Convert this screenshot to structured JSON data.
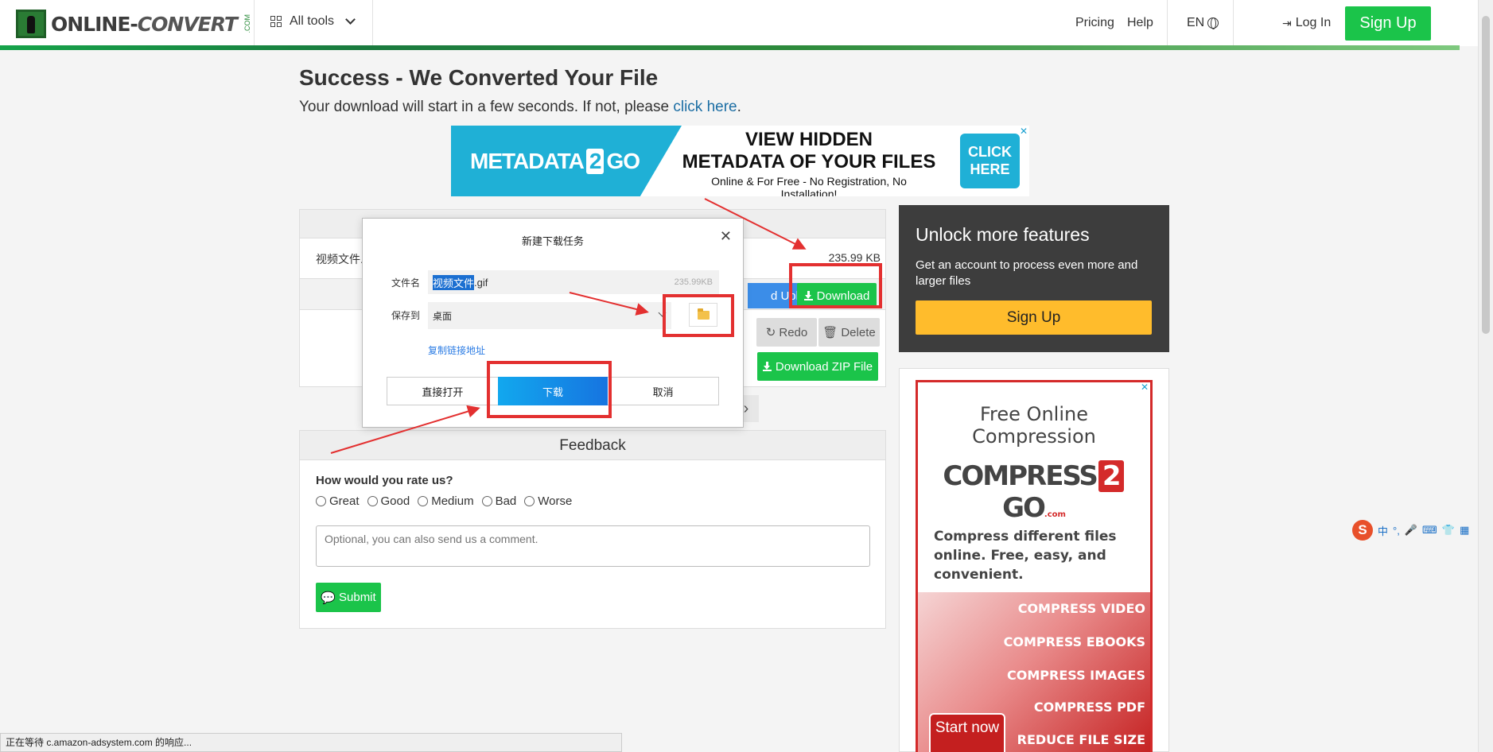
{
  "header": {
    "logo_main": "ONLINE-",
    "logo_conv": "CONVERT",
    "logo_com": ".COM",
    "all_tools": "All tools",
    "pricing": "Pricing",
    "help": "Help",
    "lang": "EN",
    "login": "Log In",
    "signup": "Sign Up"
  },
  "main": {
    "title": "Success - We Converted Your File",
    "subtitle_prefix": "Your download will start in a few seconds. If not, please ",
    "subtitle_link": "click here",
    "subtitle_suffix": "."
  },
  "banner_ad": {
    "brand_a": "METADATA",
    "brand_two": "2",
    "brand_b": "GO",
    "headline_1": "VIEW HIDDEN",
    "headline_2": "METADATA OF YOUR FILES",
    "tagline": "Online & For Free - No Registration, No Installation!",
    "cta": "CLICK HERE",
    "close": "✕"
  },
  "conversion": {
    "filename_partial": "视频文件.",
    "file_size": "235.99 KB",
    "upload_label": "d Upload",
    "download_label": "Download",
    "redo_label": "Redo",
    "delete_label": "Delete",
    "zip_label": "Download ZIP File"
  },
  "feedback": {
    "heading": "Feedback",
    "question": "How would you rate us?",
    "options": [
      "Great",
      "Good",
      "Medium",
      "Bad",
      "Worse"
    ],
    "comment_placeholder": "Optional, you can also send us a comment.",
    "submit": "Submit"
  },
  "sidebar": {
    "unlock_title": "Unlock more features",
    "unlock_desc": "Get an account to process even more and larger files",
    "unlock_button": "Sign Up",
    "ad": {
      "title": "Free Online Compression",
      "brand_a": "COMPRESS",
      "brand_two": "2",
      "brand_b": "GO",
      "brand_com": ".com",
      "desc": "Compress different files online. Free, easy, and convenient.",
      "items": [
        "COMPRESS VIDEO",
        "COMPRESS EBOOKS",
        "COMPRESS IMAGES",
        "COMPRESS PDF",
        "REDUCE FILE SIZE"
      ],
      "start": "Start now",
      "close": "✕"
    }
  },
  "dialog": {
    "title": "新建下载任务",
    "filename_label": "文件名",
    "filename_selected": "视频文件",
    "filename_ext": ".gif",
    "filesize": "235.99KB",
    "saveto_label": "保存到",
    "saveto_value": "桌面",
    "copy_link": "复制链接地址",
    "btn_open": "直接打开",
    "btn_download": "下载",
    "btn_cancel": "取消"
  },
  "ime": {
    "lang": "中",
    "punct": "°,"
  },
  "statusbar": {
    "text": "正在等待 c.amazon-adsystem.com 的响应..."
  },
  "annotation_color": "#e33030",
  "brand_green": "#1bc44a"
}
